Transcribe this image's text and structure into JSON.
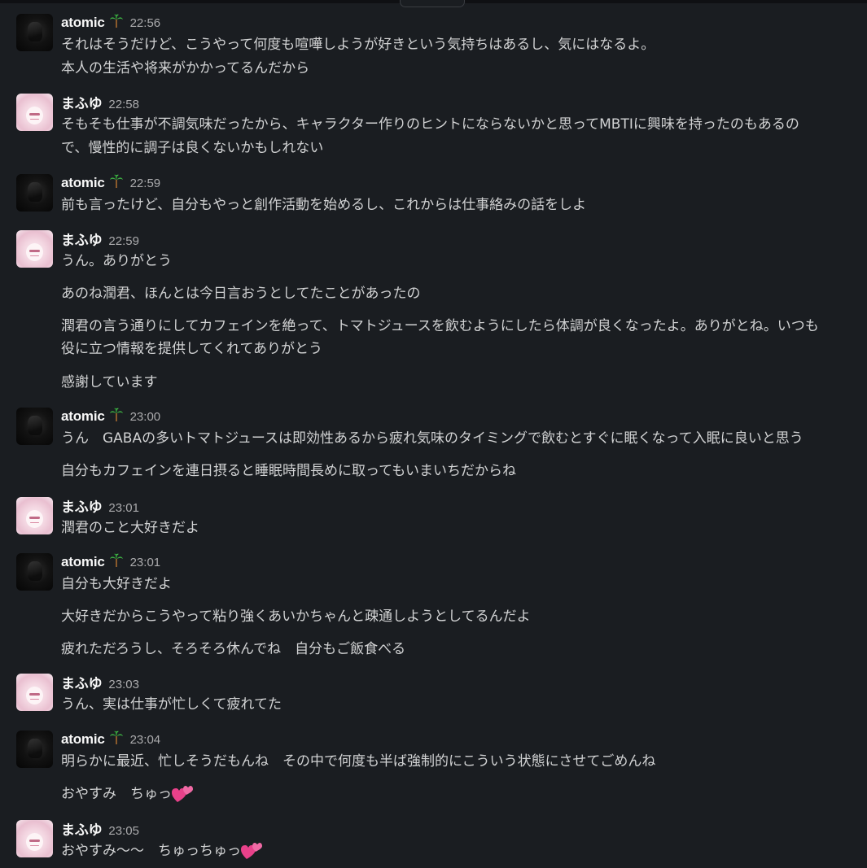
{
  "users": {
    "atomic": {
      "name": "atomic",
      "badge_icon": "palm-tree-icon"
    },
    "mafuyu": {
      "name": "まふゆ"
    }
  },
  "messages": [
    {
      "user": "atomic",
      "time": "22:56",
      "lines": [
        "それはそうだけど、こうやって何度も喧嘩しようが好きという気持ちはあるし、気にはなるよ。",
        "本人の生活や将来がかかってるんだから"
      ]
    },
    {
      "user": "まふゆ",
      "time": "22:58",
      "lines": [
        "そもそも仕事が不調気味だったから、キャラクター作りのヒントにならないかと思ってMBTIに興味を持ったのもあるの",
        "で、慢性的に調子は良くないかもしれない"
      ]
    },
    {
      "user": "atomic",
      "time": "22:59",
      "lines": [
        "前も言ったけど、自分もやっと創作活動を始めるし、これからは仕事絡みの話をしよ"
      ]
    },
    {
      "user": "まふゆ",
      "time": "22:59",
      "lines": [
        "うん。ありがとう",
        "あのね潤君、ほんとは今日言おうとしてたことがあったの",
        "潤君の言う通りにしてカフェインを絶って、トマトジュースを飲むようにしたら体調が良くなったよ。ありがとね。いつも",
        "役に立つ情報を提供してくれてありがとう",
        "感謝しています"
      ]
    },
    {
      "user": "atomic",
      "time": "23:00",
      "lines": [
        "うん　GABAの多いトマトジュースは即効性あるから疲れ気味のタイミングで飲むとすぐに眠くなって入眠に良いと思う",
        "自分もカフェインを連日摂ると睡眠時間長めに取ってもいまいちだからね"
      ]
    },
    {
      "user": "まふゆ",
      "time": "23:01",
      "lines": [
        "潤君のこと大好きだよ"
      ]
    },
    {
      "user": "atomic",
      "time": "23:01",
      "lines": [
        "自分も大好きだよ",
        "大好きだからこうやって粘り強くあいかちゃんと疎通しようとしてるんだよ",
        "疲れただろうし、そろそろ休んでね　自分もご飯食べる"
      ]
    },
    {
      "user": "まふゆ",
      "time": "23:03",
      "lines": [
        "うん、実は仕事が忙しくて疲れてた"
      ]
    },
    {
      "user": "atomic",
      "time": "23:04",
      "lines": [
        "明らかに最近、忙しそうだもんね　その中で何度も半ば強制的にこういう状態にさせてごめんね",
        "おやすみ　ちゅっ"
      ],
      "emoji": "two-hearts-icon"
    },
    {
      "user": "まふゆ",
      "time": "23:05",
      "lines": [
        "おやすみ〜〜　ちゅっちゅっ"
      ],
      "emoji": "two-hearts-icon"
    }
  ]
}
